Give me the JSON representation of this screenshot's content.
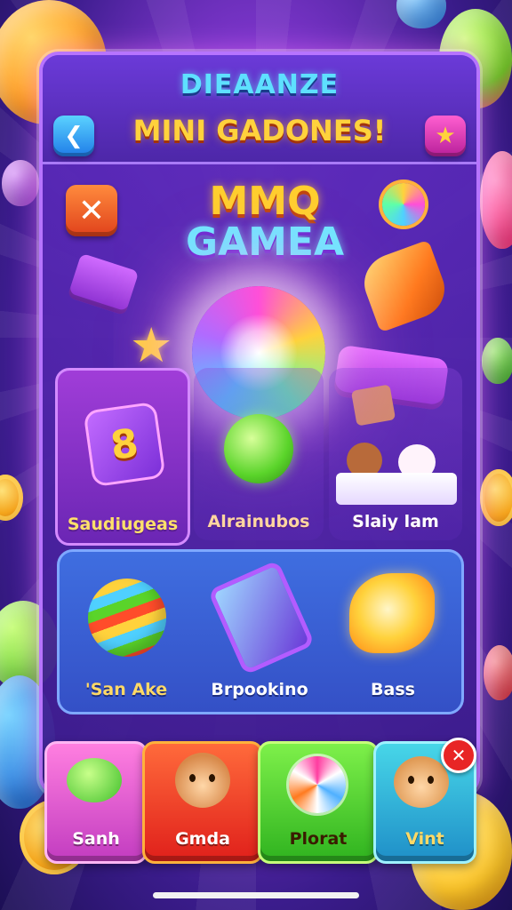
{
  "header": {
    "title_line1": "DIEAANZE",
    "title_line2": "MINI GADONES!",
    "back_icon": "arrow-left-icon",
    "star_icon": "star-icon"
  },
  "logo": {
    "line1": "MMQ",
    "line2": "GAMEA"
  },
  "featured_games": [
    {
      "label": "Saudiugeas",
      "icon": "dice-8-icon"
    },
    {
      "label": "Alrainubos",
      "icon": "green-orb-icon"
    },
    {
      "label": "Slaiy lam",
      "icon": "pets-box-icon"
    }
  ],
  "more_games": [
    {
      "label": "'San Ake",
      "icon": "striped-ball-icon"
    },
    {
      "label": "Brpookino",
      "icon": "phone-icon"
    },
    {
      "label": "Bass",
      "icon": "candy-shell-icon"
    }
  ],
  "bottom_tray": [
    {
      "label": "Sanh",
      "icon": "green-blob-icon",
      "color": "#ff7fe0"
    },
    {
      "label": "Gmda",
      "icon": "bear-icon",
      "color": "#ff6a3b"
    },
    {
      "label": "Plorat",
      "icon": "swirl-candy-icon",
      "color": "#7ef04a"
    },
    {
      "label": "Vint",
      "icon": "cat-icon",
      "color": "#47d6e8"
    }
  ],
  "colors": {
    "title_cyan": "#5ee0ff",
    "title_gold": "#ffd23c",
    "panel_purple": "#5c2abe",
    "accent_pink": "#ff4fd8"
  }
}
